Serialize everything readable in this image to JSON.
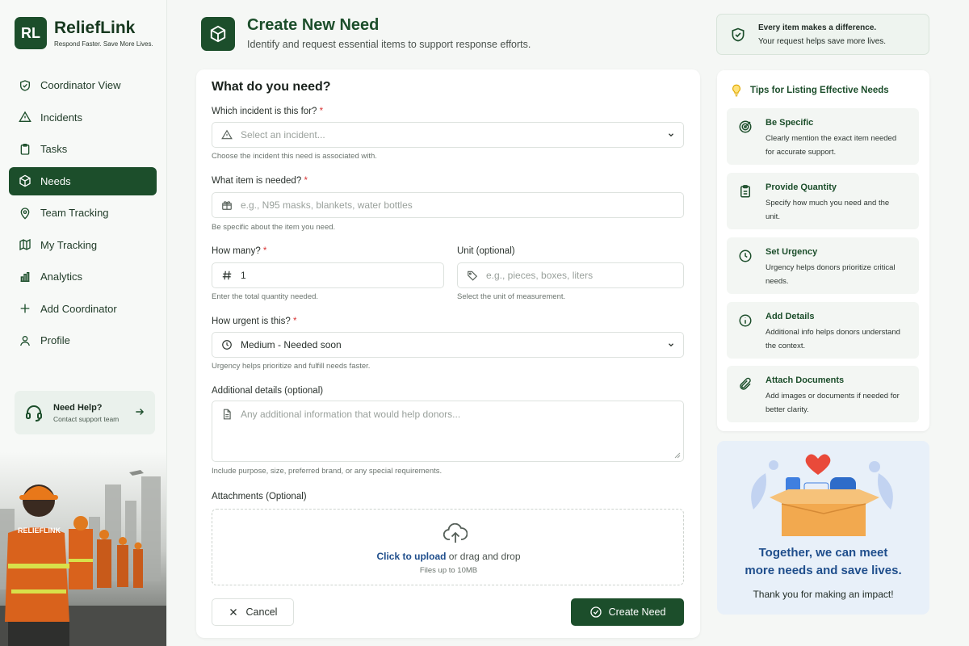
{
  "brand": {
    "mark": "RL",
    "name": "ReliefLink",
    "tagline": "Respond Faster. Save More Lives."
  },
  "nav": [
    {
      "label": "Coordinator View",
      "icon": "shield-check-icon"
    },
    {
      "label": "Incidents",
      "icon": "warning-icon"
    },
    {
      "label": "Tasks",
      "icon": "clipboard-icon"
    },
    {
      "label": "Needs",
      "icon": "box-icon",
      "active": true
    },
    {
      "label": "Team Tracking",
      "icon": "map-pin-icon"
    },
    {
      "label": "My Tracking",
      "icon": "map-icon"
    },
    {
      "label": "Analytics",
      "icon": "bar-chart-icon"
    },
    {
      "label": "Add Coordinator",
      "icon": "plus-icon"
    },
    {
      "label": "Profile",
      "icon": "user-icon"
    }
  ],
  "help": {
    "title": "Need Help?",
    "subtitle": "Contact support team"
  },
  "scene": {
    "vest_label": "RELIEFLINK"
  },
  "header": {
    "title": "Create New Need",
    "subtitle": "Identify and request essential items to support response efforts."
  },
  "form": {
    "section_title": "What do you need?",
    "incident": {
      "label": "Which incident is this for?",
      "placeholder": "Select an incident...",
      "hint": "Choose the incident this need is associated with."
    },
    "item": {
      "label": "What item is needed?",
      "placeholder": "e.g., N95 masks, blankets, water bottles",
      "hint": "Be specific about the item you need."
    },
    "quantity": {
      "label": "How many?",
      "value": "1",
      "hint": "Enter the total quantity needed."
    },
    "unit": {
      "label": "Unit (optional)",
      "placeholder": "e.g., pieces, boxes, liters",
      "hint": "Select the unit of measurement."
    },
    "urgency": {
      "label": "How urgent is this?",
      "value": "Medium - Needed soon",
      "hint": "Urgency helps prioritize and fulfill needs faster."
    },
    "details": {
      "label": "Additional details (optional)",
      "placeholder": "Any additional information that would help donors...",
      "hint": "Include purpose, size, preferred brand, or any special requirements."
    },
    "attachments": {
      "label": "Attachments (Optional)",
      "link": "Click to upload",
      "rest": " or drag and drop",
      "hint": "Files up to 10MB"
    },
    "cancel_label": "Cancel",
    "create_label": "Create Need"
  },
  "banner": {
    "line1": "Every item makes a difference.",
    "line2": "Your request helps save more lives."
  },
  "tips": {
    "title": "Tips for Listing Effective Needs",
    "items": [
      {
        "title": "Be Specific",
        "desc": "Clearly mention the exact item needed for accurate support.",
        "icon": "target-icon"
      },
      {
        "title": "Provide Quantity",
        "desc": "Specify how much you need and the unit.",
        "icon": "clipboard-list-icon"
      },
      {
        "title": "Set Urgency",
        "desc": "Urgency helps donors prioritize critical needs.",
        "icon": "clock-icon"
      },
      {
        "title": "Add Details",
        "desc": "Additional info helps donors understand the context.",
        "icon": "info-icon"
      },
      {
        "title": "Attach Documents",
        "desc": "Add images or documents if needed for better clarity.",
        "icon": "paperclip-icon"
      }
    ]
  },
  "impact": {
    "title_line1": "Together, we can meet",
    "title_line2": "more needs and save lives.",
    "subtitle": "Thank you for making an impact!"
  },
  "colors": {
    "primary": "#1c4e2b",
    "required": "#d93636",
    "link": "#1f4e8c",
    "impact_bg": "#e8f0f9"
  }
}
